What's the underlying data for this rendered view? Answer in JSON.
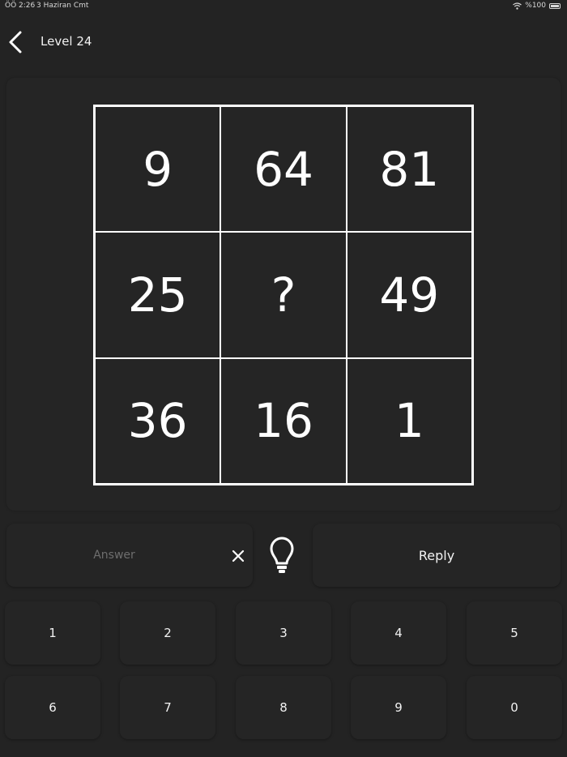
{
  "status_bar": {
    "time": "ÖÖ 2:26",
    "date": "3 Haziran Cmt",
    "battery": "%100"
  },
  "header": {
    "title": "Level 24"
  },
  "puzzle": {
    "cells": [
      "9",
      "64",
      "81",
      "25",
      "?",
      "49",
      "36",
      "16",
      "1"
    ]
  },
  "answer": {
    "placeholder": "Answer",
    "value": ""
  },
  "reply_label": "Reply",
  "keypad": {
    "keys": [
      "1",
      "2",
      "3",
      "4",
      "5",
      "6",
      "7",
      "8",
      "9",
      "0"
    ]
  }
}
